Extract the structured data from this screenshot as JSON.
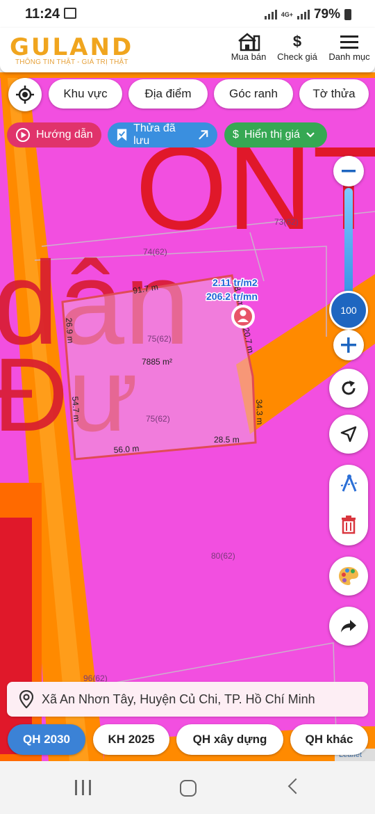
{
  "status_bar": {
    "time": "11:24",
    "network": "4G+",
    "battery": "79%"
  },
  "header": {
    "logo": "GULAND",
    "tagline": "THÔNG TIN THẬT - GIÁ TRỊ THẬT",
    "buttons": [
      {
        "label": "Mua bán",
        "icon": "store-icon"
      },
      {
        "label": "Check giá",
        "icon": "dollar-icon"
      },
      {
        "label": "Danh mục",
        "icon": "menu-icon"
      }
    ]
  },
  "filters": {
    "locate_icon": "crosshair-icon",
    "chips": [
      "Khu vực",
      "Địa điểm",
      "Góc ranh",
      "Tờ thửa"
    ]
  },
  "actions": {
    "guide": "Hướng dẫn",
    "saved": "Thửa đã lưu",
    "price": "Hiển thị giá"
  },
  "map": {
    "zone_letters": "ONT",
    "zone_bg_text_1": "dân",
    "zone_bg_text_2": "Đư",
    "parcel_labels": [
      "73(62)",
      "74(62)",
      "75(62)",
      "75(62)",
      "80(62)",
      "96(62)"
    ],
    "area": "7885 m²",
    "price_per_m2": "2.11 tr/m2",
    "price_per_mn": "206.2 tr/mn",
    "edges": [
      "91.7 m",
      "28.6 m",
      "20.7 m",
      "34.3 m",
      "28.5 m",
      "56.0 m",
      "54.7 m",
      "26.9 m"
    ],
    "zoom_level": "100",
    "attribution": "Leaflet"
  },
  "colors": {
    "residential_pink": "#f24fe0",
    "road_orange": "#ff8a00",
    "zone_red": "#e0182a",
    "brand_gold": "#f0a51e",
    "primary_blue": "#2d8ae0"
  },
  "address": "Xã An Nhơn Tây, Huyện Củ Chi, TP. Hồ Chí Minh",
  "tabs": [
    "QH 2030",
    "KH 2025",
    "QH xây dựng",
    "QH khác"
  ]
}
